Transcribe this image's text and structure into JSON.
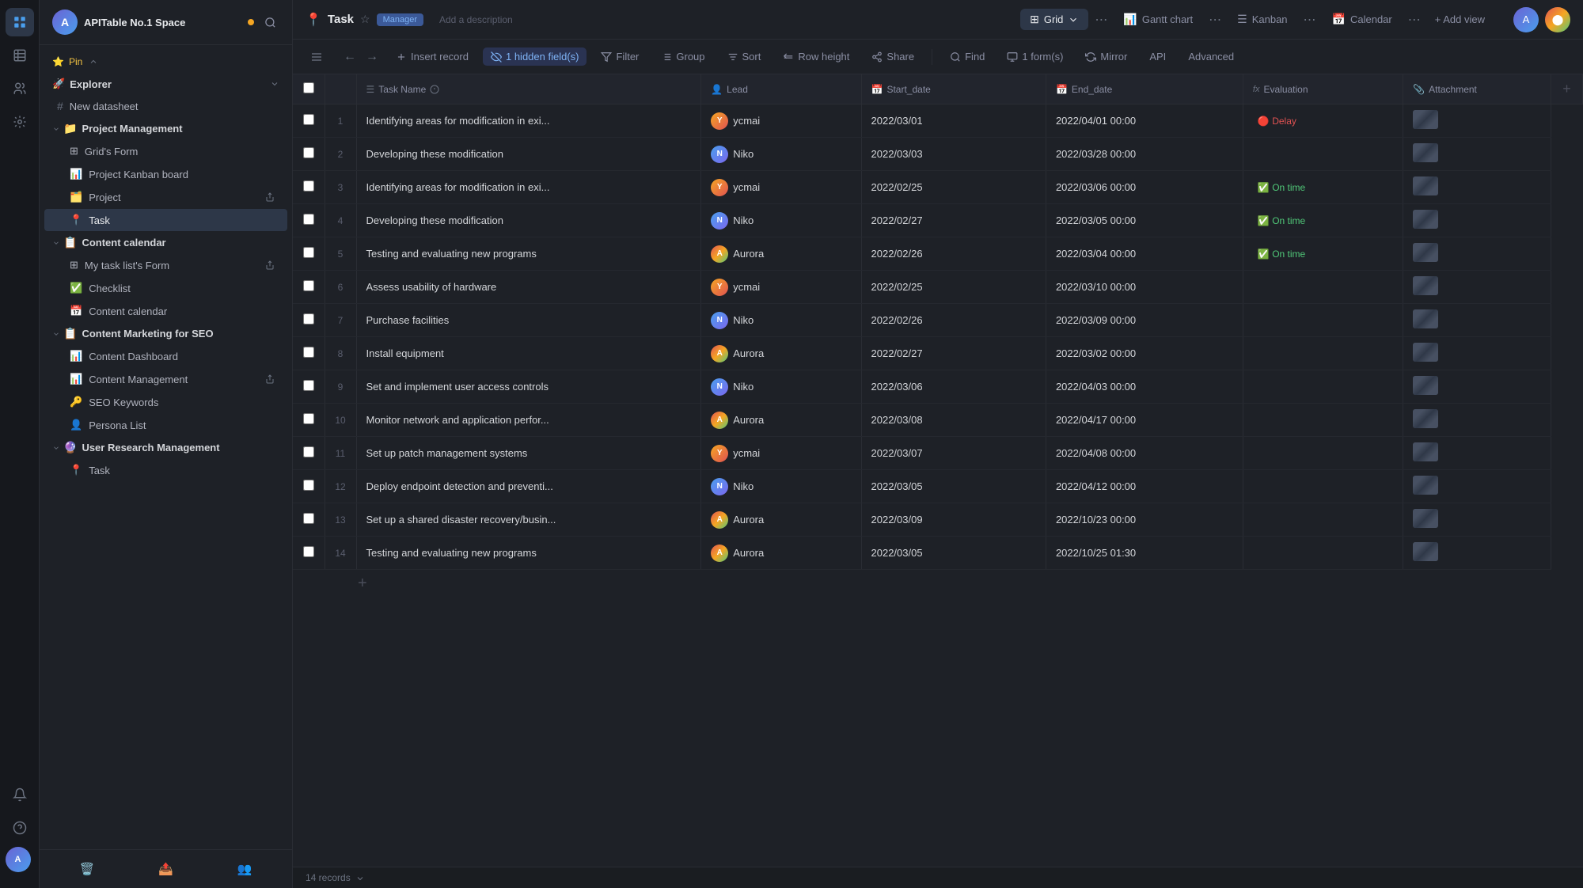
{
  "workspace": {
    "title": "APITable No.1 Space",
    "dot_color": "#f5a623"
  },
  "sidebar": {
    "pin_label": "Pin",
    "explorer_label": "Explorer",
    "new_datasheet_label": "New datasheet",
    "sections": [
      {
        "name": "Project Management",
        "icon": "📁",
        "items": [
          {
            "label": "Grid's Form",
            "icon": "⊞",
            "sub": true
          },
          {
            "label": "Project Kanban board",
            "icon": "📊",
            "sub": true
          },
          {
            "label": "Project",
            "icon": "🗂️",
            "sub": true,
            "has_share": true
          },
          {
            "label": "Task",
            "icon": "📍",
            "sub": true,
            "active": true
          }
        ]
      },
      {
        "name": "Content calendar",
        "icon": "📋",
        "items": [
          {
            "label": "My task list's Form",
            "icon": "⊞",
            "sub": true,
            "has_share": true
          },
          {
            "label": "Checklist",
            "icon": "✅",
            "sub": true
          },
          {
            "label": "Content calendar",
            "icon": "📅",
            "sub": true
          }
        ]
      },
      {
        "name": "Content Marketing for SEO",
        "icon": "📋",
        "items": [
          {
            "label": "Content Dashboard",
            "icon": "📊",
            "sub": true
          },
          {
            "label": "Content Management",
            "icon": "📊",
            "sub": true,
            "has_share": true
          },
          {
            "label": "SEO Keywords",
            "icon": "🔑",
            "sub": true
          },
          {
            "label": "Persona List",
            "icon": "👤",
            "sub": true
          }
        ]
      },
      {
        "name": "User Research Management",
        "icon": "🔮",
        "items": [
          {
            "label": "Task",
            "icon": "📍",
            "sub": true
          }
        ]
      }
    ]
  },
  "task": {
    "icon": "📍",
    "name": "Task",
    "badge": "Manager",
    "add_description": "Add a description"
  },
  "views": {
    "grid_label": "Grid",
    "gantt_label": "Gantt chart",
    "kanban_label": "Kanban",
    "calendar_label": "Calendar",
    "add_view_label": "+ Add view"
  },
  "toolbar": {
    "insert_record": "Insert record",
    "hidden_fields": "1 hidden field(s)",
    "filter": "Filter",
    "group": "Group",
    "sort": "Sort",
    "row_height": "Row height",
    "share": "Share",
    "find": "Find",
    "form_count": "1 form(s)",
    "mirror": "Mirror",
    "api": "API",
    "advanced": "Advanced"
  },
  "table": {
    "columns": [
      {
        "id": "checkbox",
        "label": "",
        "icon": ""
      },
      {
        "id": "num",
        "label": "",
        "icon": ""
      },
      {
        "id": "task_name",
        "label": "Task Name",
        "icon": "☰"
      },
      {
        "id": "lead",
        "label": "Lead",
        "icon": "👤"
      },
      {
        "id": "start_date",
        "label": "Start_date",
        "icon": "📅"
      },
      {
        "id": "end_date",
        "label": "End_date",
        "icon": "📅"
      },
      {
        "id": "evaluation",
        "label": "Evaluation",
        "icon": "fx"
      },
      {
        "id": "attachment",
        "label": "Attachment",
        "icon": "📎"
      }
    ],
    "rows": [
      {
        "num": 1,
        "task": "Identifying areas for modification in exi...",
        "lead": "ycmai",
        "lead_type": "ycmai",
        "start": "2022/03/01",
        "end": "2022/04/01 00:00",
        "eval": "🔴 Delay",
        "eval_type": "delay"
      },
      {
        "num": 2,
        "task": "Developing these modification",
        "lead": "Niko",
        "lead_type": "niko",
        "start": "2022/03/03",
        "end": "2022/03/28 00:00",
        "eval": "",
        "eval_type": ""
      },
      {
        "num": 3,
        "task": "Identifying areas for modification in exi...",
        "lead": "ycmai",
        "lead_type": "ycmai",
        "start": "2022/02/25",
        "end": "2022/03/06 00:00",
        "eval": "✅ On time",
        "eval_type": "ontime"
      },
      {
        "num": 4,
        "task": "Developing these modification",
        "lead": "Niko",
        "lead_type": "niko",
        "start": "2022/02/27",
        "end": "2022/03/05 00:00",
        "eval": "✅ On time",
        "eval_type": "ontime"
      },
      {
        "num": 5,
        "task": "Testing and evaluating new programs",
        "lead": "Aurora",
        "lead_type": "aurora",
        "start": "2022/02/26",
        "end": "2022/03/04 00:00",
        "eval": "✅ On time",
        "eval_type": "ontime"
      },
      {
        "num": 6,
        "task": "Assess usability of hardware",
        "lead": "ycmai",
        "lead_type": "ycmai",
        "start": "2022/02/25",
        "end": "2022/03/10 00:00",
        "eval": "",
        "eval_type": ""
      },
      {
        "num": 7,
        "task": "Purchase facilities",
        "lead": "Niko",
        "lead_type": "niko",
        "start": "2022/02/26",
        "end": "2022/03/09 00:00",
        "eval": "",
        "eval_type": ""
      },
      {
        "num": 8,
        "task": "Install equipment",
        "lead": "Aurora",
        "lead_type": "aurora",
        "start": "2022/02/27",
        "end": "2022/03/02 00:00",
        "eval": "",
        "eval_type": ""
      },
      {
        "num": 9,
        "task": "Set and implement user access controls",
        "lead": "Niko",
        "lead_type": "niko",
        "start": "2022/03/06",
        "end": "2022/04/03 00:00",
        "eval": "",
        "eval_type": ""
      },
      {
        "num": 10,
        "task": "Monitor network and application perfor...",
        "lead": "Aurora",
        "lead_type": "aurora",
        "start": "2022/03/08",
        "end": "2022/04/17 00:00",
        "eval": "",
        "eval_type": ""
      },
      {
        "num": 11,
        "task": "Set up patch management systems",
        "lead": "ycmai",
        "lead_type": "ycmai",
        "start": "2022/03/07",
        "end": "2022/04/08 00:00",
        "eval": "",
        "eval_type": ""
      },
      {
        "num": 12,
        "task": "Deploy endpoint detection and preventi...",
        "lead": "Niko",
        "lead_type": "niko",
        "start": "2022/03/05",
        "end": "2022/04/12 00:00",
        "eval": "",
        "eval_type": ""
      },
      {
        "num": 13,
        "task": "Set up a shared disaster recovery/busin...",
        "lead": "Aurora",
        "lead_type": "aurora",
        "start": "2022/03/09",
        "end": "2022/10/23 00:00",
        "eval": "",
        "eval_type": ""
      },
      {
        "num": 14,
        "task": "Testing and evaluating new programs",
        "lead": "Aurora",
        "lead_type": "aurora",
        "start": "2022/03/05",
        "end": "2022/10/25 01:30",
        "eval": "",
        "eval_type": ""
      }
    ],
    "records_label": "14 records"
  }
}
